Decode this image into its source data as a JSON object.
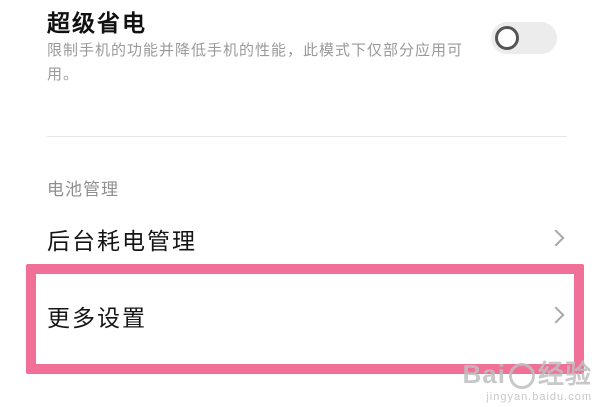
{
  "super_power": {
    "title": "超级省电",
    "description": "限制手机的功能并降低手机的性能，此模式下仅部分应用可用。",
    "toggle_state": "off"
  },
  "battery_section": {
    "header": "电池管理",
    "items": [
      {
        "label": "后台耗电管理",
        "icon": "chevron-right-icon"
      },
      {
        "label": "更多设置",
        "icon": "chevron-right-icon"
      }
    ]
  },
  "highlight_color": "#f07098",
  "watermark": {
    "main_left": "Bai",
    "main_right": "经验",
    "sub": "jingyan.baidu.com"
  }
}
